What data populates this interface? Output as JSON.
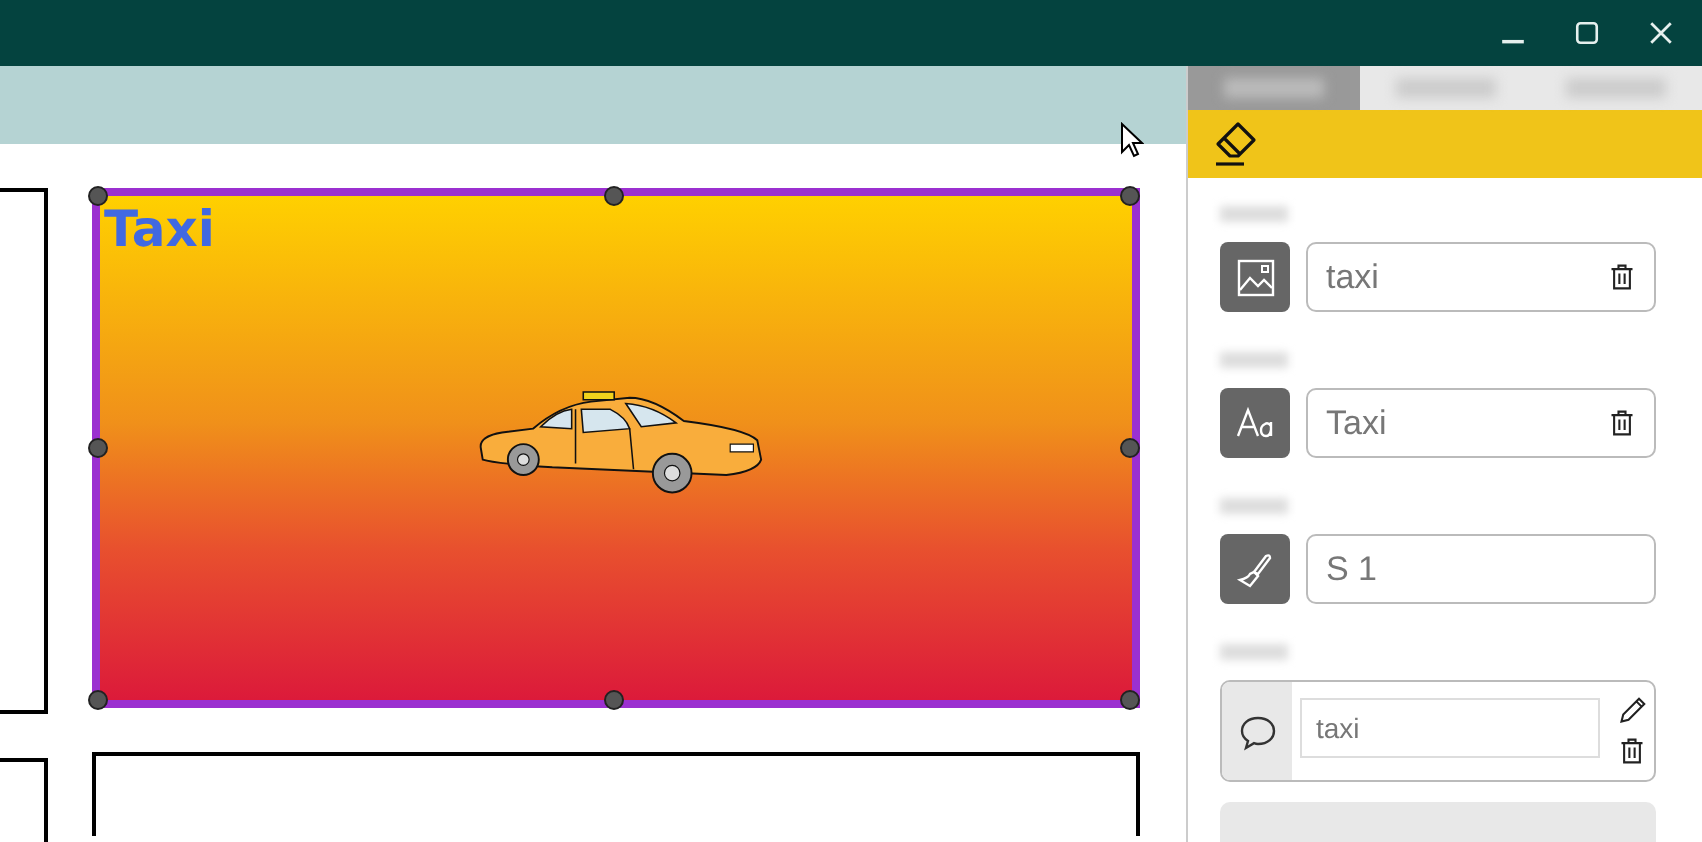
{
  "panel_tabs": [
    {
      "selected": true
    },
    {
      "selected": false
    },
    {
      "selected": false
    }
  ],
  "canvas": {
    "card": {
      "label": "Taxi",
      "selected": true
    }
  },
  "properties": [
    {
      "kind": "image",
      "value": "taxi",
      "deletable": true
    },
    {
      "kind": "text",
      "value": "Taxi",
      "deletable": true
    },
    {
      "kind": "style",
      "value": "S 1",
      "deletable": false
    },
    {
      "kind": "comment",
      "value": "taxi",
      "deletable": true
    }
  ]
}
